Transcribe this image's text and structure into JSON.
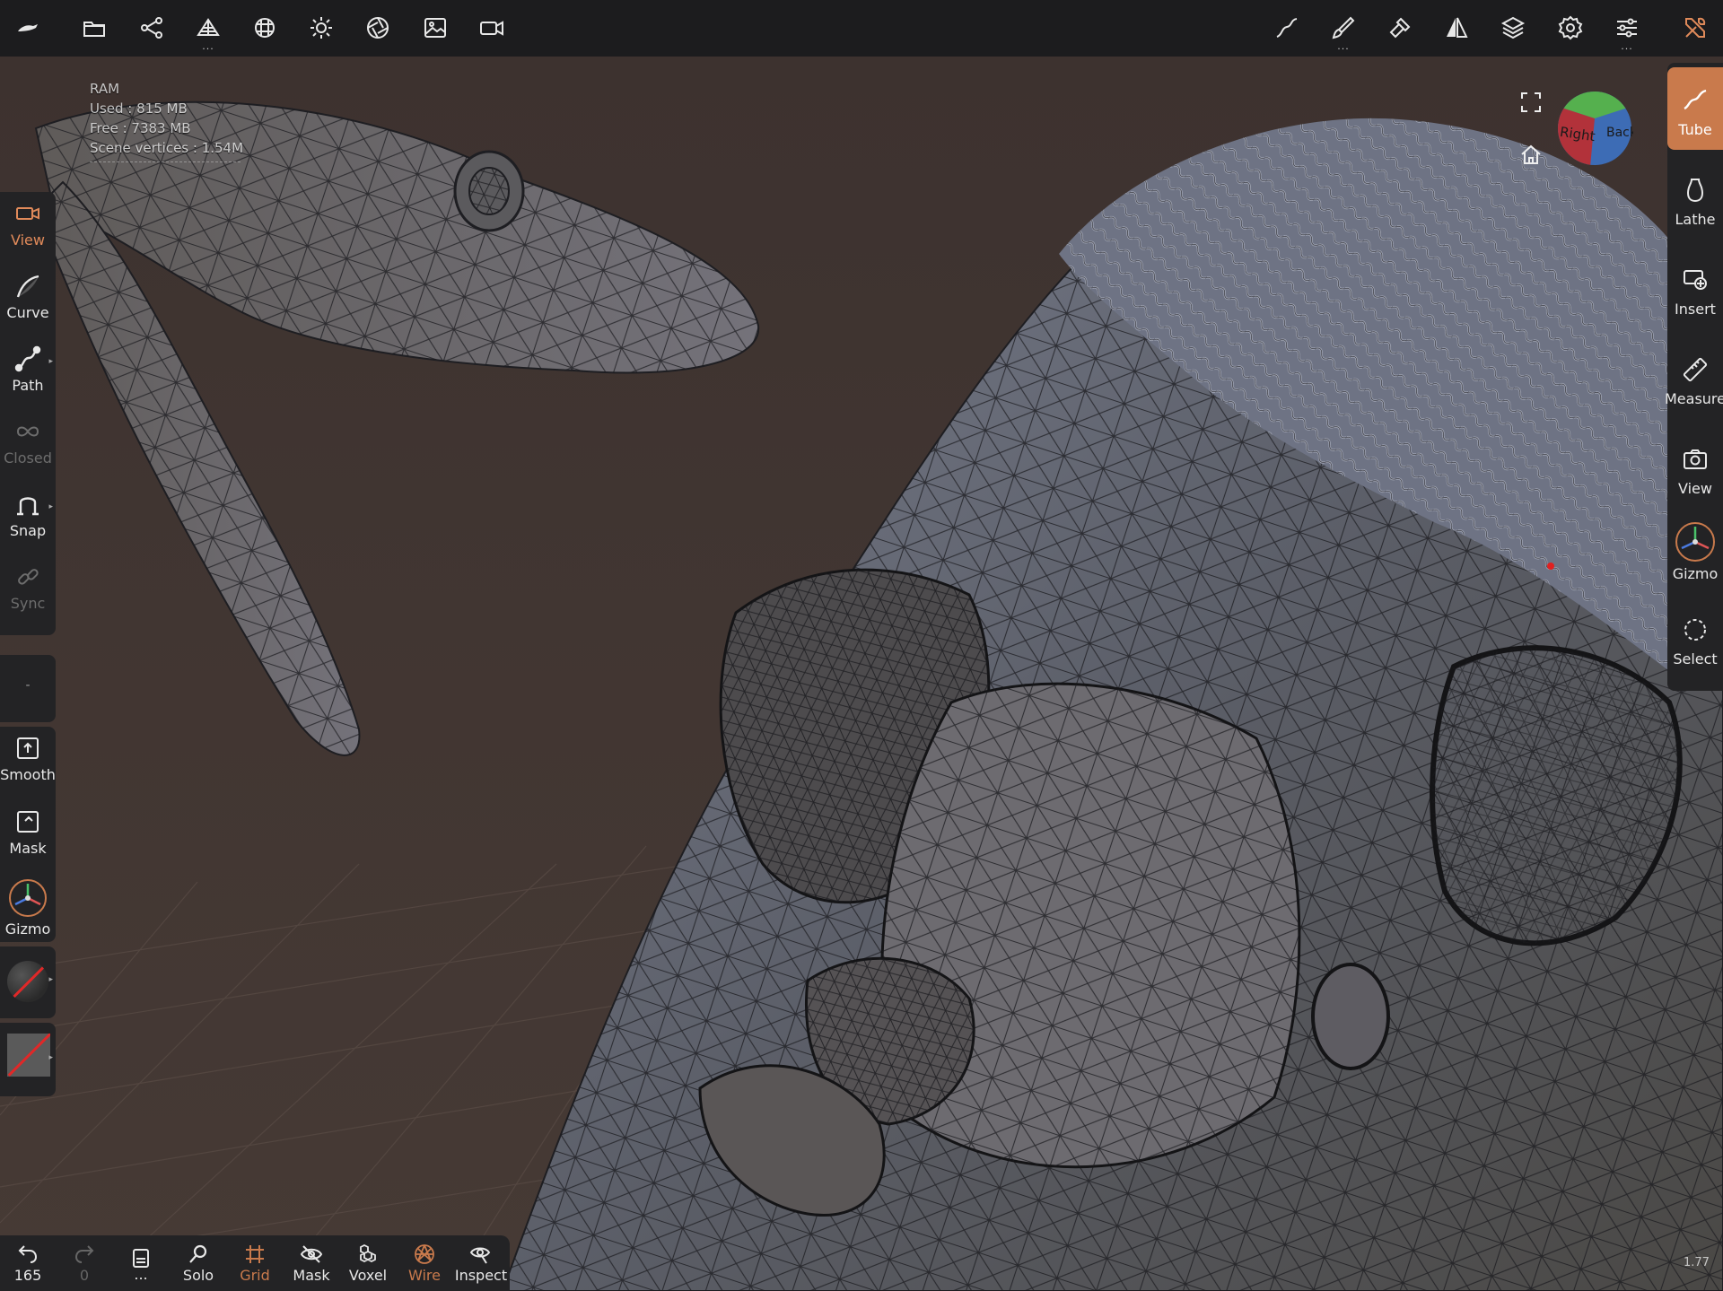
{
  "topbar": {
    "left_icons": [
      "sculpt-logo-icon",
      "folder-icon",
      "scene-graph-icon",
      "mesh-icon",
      "topology-icon",
      "sun-icon",
      "aperture-icon",
      "image-icon",
      "camera-icon"
    ],
    "right_icons": [
      "stroke-icon",
      "brush-icon",
      "hammer-icon",
      "symmetry-icon",
      "layers-icon",
      "settings-icon",
      "sliders-icon",
      "tools-icon"
    ],
    "dots": "..."
  },
  "ram": {
    "title": "RAM",
    "used": "Used : 815 MB",
    "free": "Free : 7383 MB",
    "vertices": "Scene vertices : 1.54M"
  },
  "left_toolbar": {
    "items": [
      {
        "label": "View",
        "icon": "video-camera-icon",
        "state": "active"
      },
      {
        "label": "Curve",
        "icon": "curve-icon",
        "state": "normal"
      },
      {
        "label": "Path",
        "icon": "path-icon",
        "state": "normal"
      },
      {
        "label": "Closed",
        "icon": "infinity-icon",
        "state": "disabled"
      },
      {
        "label": "Snap",
        "icon": "magnet-icon",
        "state": "normal"
      },
      {
        "label": "Sync",
        "icon": "link-icon",
        "state": "disabled"
      }
    ],
    "separator": "-",
    "items2": [
      {
        "label": "Smooth",
        "icon": "smooth-icon"
      },
      {
        "label": "Mask",
        "icon": "mask-icon"
      },
      {
        "label": "Gizmo",
        "icon": "gizmo-icon"
      }
    ]
  },
  "right_toolbar": {
    "items": [
      {
        "label": "Tube",
        "icon": "tube-icon",
        "state": "active"
      },
      {
        "label": "Lathe",
        "icon": "lathe-icon",
        "state": "normal"
      },
      {
        "label": "Insert",
        "icon": "insert-icon",
        "state": "normal"
      },
      {
        "label": "Measure",
        "icon": "ruler-icon",
        "state": "normal"
      },
      {
        "label": "View",
        "icon": "camera-icon",
        "state": "normal"
      },
      {
        "label": "Gizmo",
        "icon": "gizmo-icon",
        "state": "normal"
      },
      {
        "label": "Select",
        "icon": "select-icon",
        "state": "normal"
      }
    ]
  },
  "navcube": {
    "right": "Right",
    "back": "Back"
  },
  "bottom_toolbar": {
    "items": [
      {
        "label": "165",
        "icon": "undo-icon"
      },
      {
        "label": "0",
        "icon": "redo-icon"
      },
      {
        "label": "...",
        "icon": "document-icon"
      },
      {
        "label": "Solo",
        "icon": "search-icon"
      },
      {
        "label": "Grid",
        "icon": "grid-icon"
      },
      {
        "label": "Mask",
        "icon": "eye-slash-icon"
      },
      {
        "label": "Voxel",
        "icon": "voxel-icon"
      },
      {
        "label": "Wire",
        "icon": "wireframe-icon"
      },
      {
        "label": "Inspect",
        "icon": "inspect-icon"
      }
    ]
  },
  "corner_value": "1.77",
  "colors": {
    "background": "#3a302d",
    "panel": "#232325",
    "topbar": "#1c1c1e",
    "accent": "#c97a4c",
    "mesh": "#6a6f7c"
  }
}
